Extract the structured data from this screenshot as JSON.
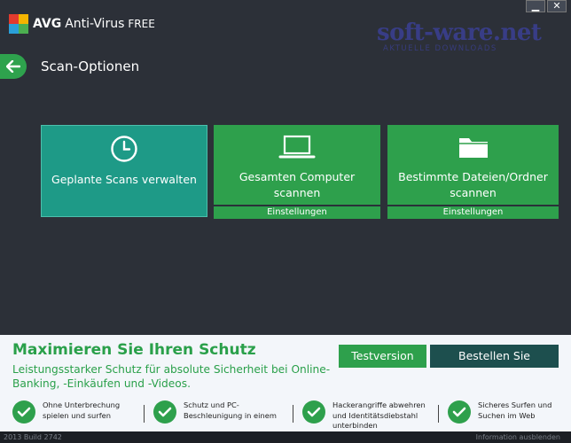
{
  "app": {
    "brand": "AVG",
    "name": "Anti-Virus",
    "edition": "FREE"
  },
  "watermark": {
    "main": "soft-ware.net",
    "sub": "AKTUELLE DOWNLOADS"
  },
  "window": {
    "minimize": "▁",
    "close": "✕"
  },
  "page": {
    "title": "Scan-Optionen"
  },
  "tiles": [
    {
      "label": "Geplante Scans verwalten",
      "icon": "clock-icon"
    },
    {
      "label": "Gesamten Computer scannen",
      "icon": "laptop-icon",
      "settings": "Einstellungen"
    },
    {
      "label": "Bestimmte Dateien/Ordner scannen",
      "icon": "folder-icon",
      "settings": "Einstellungen"
    }
  ],
  "promo": {
    "title": "Maximieren Sie Ihren Schutz",
    "description": "Leistungsstarker Schutz für absolute Sicherheit bei Online-Banking, -Einkäufen und -Videos.",
    "trial_button": "Testversion",
    "order_button": "Bestellen Sie",
    "features": [
      "Ohne Unterbrechung spielen und surfen",
      "Schutz und PC-Beschleunigung in einem",
      "Hackerangriffe abwehren und Identitätsdiebstahl unterbinden",
      "Sicheres Surfen und Suchen im Web"
    ]
  },
  "status": {
    "version": "2013  Build 2742",
    "hide_info": "Information ausblenden"
  },
  "colors": {
    "background": "#2c3038",
    "green": "#2ea04c",
    "teal": "#1e9a87",
    "dark_teal": "#1d4f4e"
  }
}
